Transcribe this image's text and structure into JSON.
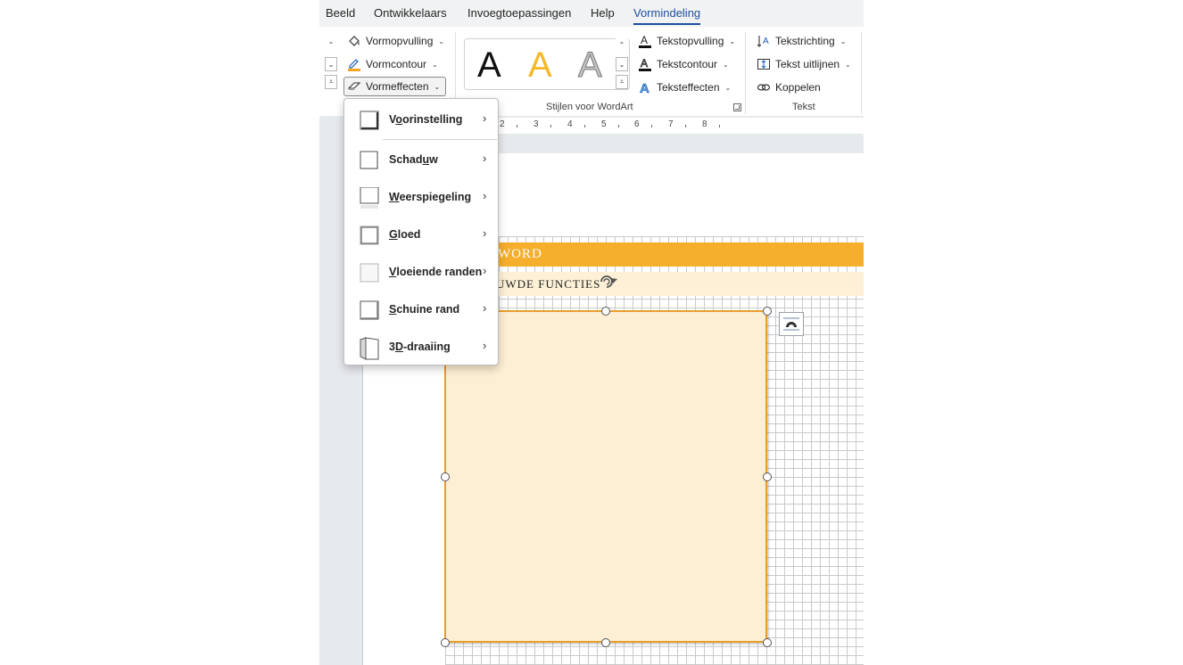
{
  "tabs": [
    {
      "label": "Beeld"
    },
    {
      "label": "Ontwikkelaars"
    },
    {
      "label": "Invoegtoepassingen"
    },
    {
      "label": "Help"
    },
    {
      "label": "Vormindeling"
    }
  ],
  "active_tab": "Vormindeling",
  "shape_styles": {
    "fill": "Vormopvulling",
    "outline": "Vormcontour",
    "effects": "Vormeffecten"
  },
  "wordart": {
    "group_label": "Stijlen voor WordArt",
    "gallery": [
      {
        "glyph": "A",
        "color": "#111111"
      },
      {
        "glyph": "A",
        "color": "#f5b829"
      },
      {
        "glyph": "A",
        "color": "#bdbdbd"
      }
    ],
    "text_fill": "Tekstopvulling",
    "text_outline": "Tekstcontour",
    "text_effects": "Teksteffecten"
  },
  "text_group": {
    "label": "Tekst",
    "direction": "Tekstrichting",
    "align": "Tekst uitlijnen",
    "link": "Koppelen"
  },
  "ruler": {
    "numbers": [
      "2",
      "3",
      "4",
      "5",
      "6",
      "7",
      "8"
    ]
  },
  "document": {
    "title_partial": "WORD",
    "subtitle_partial": "UWDE FUNCTIES",
    "accent_color": "#f6ae2d",
    "shape_fill": "#fdefd3",
    "shape_border": "#e99e2a"
  },
  "menu": {
    "items": [
      {
        "label": "Voorinstelling",
        "access_key": "o",
        "icon": "preset-icon"
      },
      {
        "label": "Schaduw",
        "access_key": "u",
        "icon": "shadow-icon"
      },
      {
        "label": "Weerspiegeling",
        "access_key": "W",
        "icon": "reflection-icon"
      },
      {
        "label": "Gloed",
        "access_key": "G",
        "icon": "glow-icon"
      },
      {
        "label": "Vloeiende randen",
        "access_key": "V",
        "icon": "soft-edges-icon"
      },
      {
        "label": "Schuine rand",
        "access_key": "S",
        "icon": "bevel-icon"
      },
      {
        "label": "3D-draaiing",
        "access_key": "D",
        "icon": "3d-rotation-icon"
      }
    ]
  }
}
